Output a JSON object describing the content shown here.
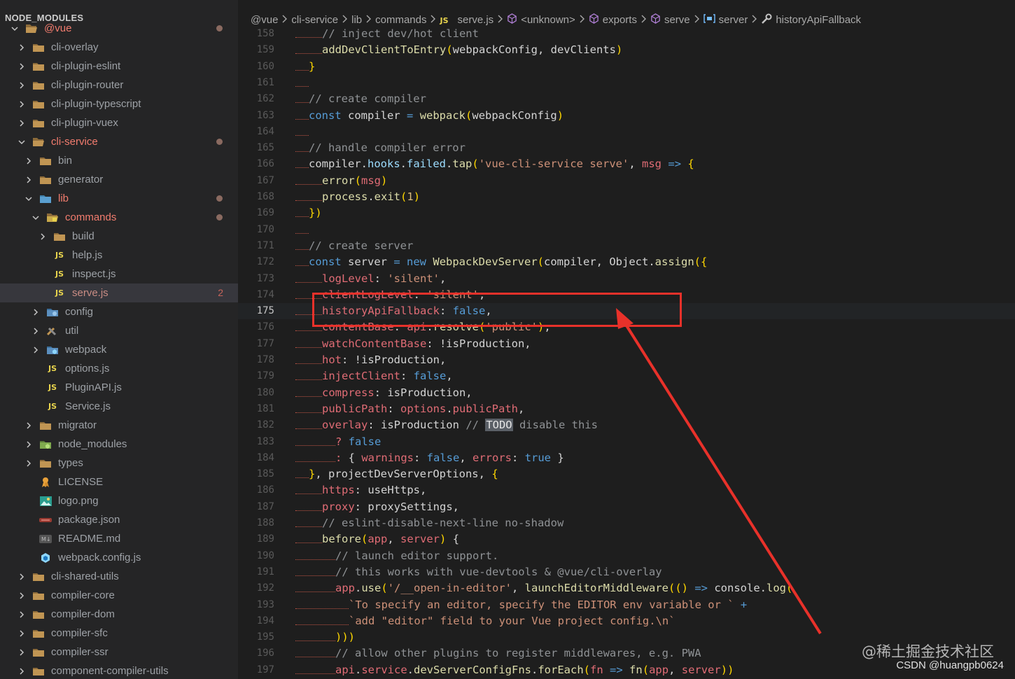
{
  "sidebar": {
    "title": "NODE_MODULES",
    "items": [
      {
        "label": "@vue",
        "icon": "folder-open-icon",
        "chevron": "down",
        "indent": 0,
        "state": "red",
        "dot": true
      },
      {
        "label": "cli-overlay",
        "icon": "folder-icon",
        "chevron": "right",
        "indent": 1,
        "state": ""
      },
      {
        "label": "cli-plugin-eslint",
        "icon": "folder-icon",
        "chevron": "right",
        "indent": 1,
        "state": ""
      },
      {
        "label": "cli-plugin-router",
        "icon": "folder-icon",
        "chevron": "right",
        "indent": 1,
        "state": ""
      },
      {
        "label": "cli-plugin-typescript",
        "icon": "folder-icon",
        "chevron": "right",
        "indent": 1,
        "state": ""
      },
      {
        "label": "cli-plugin-vuex",
        "icon": "folder-icon",
        "chevron": "right",
        "indent": 1,
        "state": ""
      },
      {
        "label": "cli-service",
        "icon": "folder-open-icon",
        "chevron": "down",
        "indent": 1,
        "state": "red",
        "dot": true
      },
      {
        "label": "bin",
        "icon": "bin-folder-icon",
        "chevron": "right",
        "indent": 2,
        "state": ""
      },
      {
        "label": "generator",
        "icon": "folder-icon",
        "chevron": "right",
        "indent": 2,
        "state": ""
      },
      {
        "label": "lib",
        "icon": "lib-folder-icon",
        "chevron": "down",
        "indent": 2,
        "state": "red",
        "dot": true
      },
      {
        "label": "commands",
        "icon": "commands-folder-icon",
        "chevron": "down",
        "indent": 3,
        "state": "red",
        "dot": true
      },
      {
        "label": "build",
        "icon": "folder-icon",
        "chevron": "right",
        "indent": 4,
        "state": ""
      },
      {
        "label": "help.js",
        "icon": "js-file-icon",
        "chevron": "none",
        "indent": 4,
        "state": ""
      },
      {
        "label": "inspect.js",
        "icon": "js-file-icon",
        "chevron": "none",
        "indent": 4,
        "state": ""
      },
      {
        "label": "serve.js",
        "icon": "js-file-icon",
        "chevron": "none",
        "indent": 4,
        "state": "redfaded",
        "active": true,
        "count": "2"
      },
      {
        "label": "config",
        "icon": "config-folder-icon",
        "chevron": "right",
        "indent": 3,
        "state": ""
      },
      {
        "label": "util",
        "icon": "util-folder-icon",
        "chevron": "right",
        "indent": 3,
        "state": ""
      },
      {
        "label": "webpack",
        "icon": "webpack-folder-icon",
        "chevron": "right",
        "indent": 3,
        "state": ""
      },
      {
        "label": "options.js",
        "icon": "js-file-icon",
        "chevron": "none",
        "indent": 3,
        "state": ""
      },
      {
        "label": "PluginAPI.js",
        "icon": "js-file-icon",
        "chevron": "none",
        "indent": 3,
        "state": ""
      },
      {
        "label": "Service.js",
        "icon": "js-file-icon",
        "chevron": "none",
        "indent": 3,
        "state": ""
      },
      {
        "label": "migrator",
        "icon": "folder-icon",
        "chevron": "right",
        "indent": 2,
        "state": ""
      },
      {
        "label": "node_modules",
        "icon": "node-folder-icon",
        "chevron": "right",
        "indent": 2,
        "state": ""
      },
      {
        "label": "types",
        "icon": "folder-icon",
        "chevron": "right",
        "indent": 2,
        "state": ""
      },
      {
        "label": "LICENSE",
        "icon": "license-icon",
        "chevron": "none",
        "indent": 2,
        "state": ""
      },
      {
        "label": "logo.png",
        "icon": "image-icon",
        "chevron": "none",
        "indent": 2,
        "state": ""
      },
      {
        "label": "package.json",
        "icon": "json-icon",
        "chevron": "none",
        "indent": 2,
        "state": ""
      },
      {
        "label": "README.md",
        "icon": "markdown-icon",
        "chevron": "none",
        "indent": 2,
        "state": ""
      },
      {
        "label": "webpack.config.js",
        "icon": "webpack-icon",
        "chevron": "none",
        "indent": 2,
        "state": ""
      },
      {
        "label": "cli-shared-utils",
        "icon": "folder-icon",
        "chevron": "right",
        "indent": 1,
        "state": ""
      },
      {
        "label": "compiler-core",
        "icon": "folder-icon",
        "chevron": "right",
        "indent": 1,
        "state": ""
      },
      {
        "label": "compiler-dom",
        "icon": "folder-icon",
        "chevron": "right",
        "indent": 1,
        "state": ""
      },
      {
        "label": "compiler-sfc",
        "icon": "folder-icon",
        "chevron": "right",
        "indent": 1,
        "state": ""
      },
      {
        "label": "compiler-ssr",
        "icon": "folder-icon",
        "chevron": "right",
        "indent": 1,
        "state": ""
      },
      {
        "label": "component-compiler-utils",
        "icon": "folder-icon",
        "chevron": "right",
        "indent": 1,
        "state": ""
      }
    ]
  },
  "breadcrumb": [
    {
      "label": "@vue",
      "icon": ""
    },
    {
      "label": "cli-service",
      "icon": ""
    },
    {
      "label": "lib",
      "icon": ""
    },
    {
      "label": "commands",
      "icon": ""
    },
    {
      "label": "serve.js",
      "icon": "js-file-icon"
    },
    {
      "label": "<unknown>",
      "icon": "module-icon"
    },
    {
      "label": "exports",
      "icon": "module-icon"
    },
    {
      "label": "serve",
      "icon": "module-icon"
    },
    {
      "label": "server",
      "icon": "variable-icon"
    },
    {
      "label": "historyApiFallback",
      "icon": "wrench-icon"
    }
  ],
  "editor": {
    "current_line": 175,
    "lines": [
      {
        "n": "158",
        "indent": 2,
        "t": [
          [
            "c",
            "// inject dev/hot client"
          ]
        ]
      },
      {
        "n": "159",
        "indent": 2,
        "t": [
          [
            "f",
            "addDevClientToEntry"
          ],
          [
            "b",
            "("
          ],
          [
            "",
            "webpackConfig, devClients"
          ],
          [
            "b",
            ")"
          ]
        ]
      },
      {
        "n": "160",
        "indent": 1,
        "t": [
          [
            "b",
            "}"
          ]
        ]
      },
      {
        "n": "161",
        "indent": 0,
        "t": []
      },
      {
        "n": "162",
        "indent": 1,
        "t": [
          [
            "c",
            "// create compiler"
          ]
        ]
      },
      {
        "n": "163",
        "indent": 1,
        "t": [
          [
            "k",
            "const"
          ],
          [
            "",
            " compiler "
          ],
          [
            "k",
            "="
          ],
          [
            "",
            " "
          ],
          [
            "f",
            "webpack"
          ],
          [
            "b",
            "("
          ],
          [
            "",
            "webpackConfig"
          ],
          [
            "b",
            ")"
          ]
        ]
      },
      {
        "n": "164",
        "indent": 0,
        "t": []
      },
      {
        "n": "165",
        "indent": 1,
        "t": [
          [
            "c",
            "// handle compiler error"
          ]
        ]
      },
      {
        "n": "166",
        "indent": 1,
        "t": [
          [
            "",
            "compiler."
          ],
          [
            "v",
            "hooks"
          ],
          [
            "",
            "."
          ],
          [
            "v",
            "failed"
          ],
          [
            "",
            "."
          ],
          [
            "f",
            "tap"
          ],
          [
            "b",
            "("
          ],
          [
            "s",
            "'vue-cli-service serve'"
          ],
          [
            "",
            ", "
          ],
          [
            "p",
            "msg"
          ],
          [
            "",
            " "
          ],
          [
            "k",
            "=>"
          ],
          [
            "",
            " "
          ],
          [
            "b",
            "{"
          ]
        ]
      },
      {
        "n": "167",
        "indent": 2,
        "t": [
          [
            "f",
            "error"
          ],
          [
            "b",
            "("
          ],
          [
            "p",
            "msg"
          ],
          [
            "b",
            ")"
          ]
        ]
      },
      {
        "n": "168",
        "indent": 2,
        "t": [
          [
            "f",
            "process"
          ],
          [
            "",
            "."
          ],
          [
            "f",
            "exit"
          ],
          [
            "b",
            "("
          ],
          [
            "sy",
            "1"
          ],
          [
            "b",
            ")"
          ]
        ]
      },
      {
        "n": "169",
        "indent": 1,
        "t": [
          [
            "b",
            "})"
          ]
        ]
      },
      {
        "n": "170",
        "indent": 0,
        "t": []
      },
      {
        "n": "171",
        "indent": 1,
        "t": [
          [
            "c",
            "// create server"
          ]
        ]
      },
      {
        "n": "172",
        "indent": 1,
        "t": [
          [
            "k",
            "const"
          ],
          [
            "",
            " server "
          ],
          [
            "k",
            "="
          ],
          [
            "",
            " "
          ],
          [
            "k",
            "new"
          ],
          [
            "",
            " "
          ],
          [
            "f",
            "WebpackDevServer"
          ],
          [
            "b",
            "("
          ],
          [
            "",
            "compiler, Object."
          ],
          [
            "f",
            "assign"
          ],
          [
            "b",
            "({"
          ]
        ]
      },
      {
        "n": "173",
        "indent": 2,
        "t": [
          [
            "p",
            "logLevel"
          ],
          [
            "",
            ": "
          ],
          [
            "s",
            "'silent'"
          ],
          [
            "",
            ","
          ]
        ]
      },
      {
        "n": "174",
        "indent": 2,
        "t": [
          [
            "p",
            "clientLogLevel"
          ],
          [
            "",
            ": "
          ],
          [
            "s",
            "'silent'"
          ],
          [
            "",
            ","
          ]
        ]
      },
      {
        "n": "175",
        "indent": 2,
        "t": [
          [
            "p",
            "historyApiFallback"
          ],
          [
            "",
            ": "
          ],
          [
            "k",
            "false"
          ],
          [
            "",
            ","
          ]
        ]
      },
      {
        "n": "176",
        "indent": 2,
        "t": [
          [
            "p",
            "contentBase"
          ],
          [
            "",
            ": "
          ],
          [
            "p",
            "api"
          ],
          [
            "",
            "."
          ],
          [
            "f",
            "resolve"
          ],
          [
            "b",
            "("
          ],
          [
            "s",
            "'public'"
          ],
          [
            "b",
            ")"
          ],
          [
            "",
            ","
          ]
        ]
      },
      {
        "n": "177",
        "indent": 2,
        "t": [
          [
            "p",
            "watchContentBase"
          ],
          [
            "",
            ": !isProduction,"
          ]
        ]
      },
      {
        "n": "178",
        "indent": 2,
        "t": [
          [
            "p",
            "hot"
          ],
          [
            "",
            ": !isProduction,"
          ]
        ]
      },
      {
        "n": "179",
        "indent": 2,
        "t": [
          [
            "p",
            "injectClient"
          ],
          [
            "",
            ": "
          ],
          [
            "k",
            "false"
          ],
          [
            "",
            ","
          ]
        ]
      },
      {
        "n": "180",
        "indent": 2,
        "t": [
          [
            "p",
            "compress"
          ],
          [
            "",
            ": isProduction,"
          ]
        ]
      },
      {
        "n": "181",
        "indent": 2,
        "t": [
          [
            "p",
            "publicPath"
          ],
          [
            "",
            ": "
          ],
          [
            "p",
            "options"
          ],
          [
            "",
            "."
          ],
          [
            "p",
            "publicPath"
          ],
          [
            "",
            ","
          ]
        ]
      },
      {
        "n": "182",
        "indent": 2,
        "t": [
          [
            "p",
            "overlay"
          ],
          [
            "",
            ": isProduction "
          ],
          [
            "c",
            "// "
          ],
          [
            "todo",
            "TODO"
          ],
          [
            "c",
            " disable this"
          ]
        ]
      },
      {
        "n": "183",
        "indent": 3,
        "t": [
          [
            "p",
            "?"
          ],
          [
            "",
            " "
          ],
          [
            "k",
            "false"
          ]
        ]
      },
      {
        "n": "184",
        "indent": 3,
        "t": [
          [
            "p",
            ":"
          ],
          [
            "",
            " { "
          ],
          [
            "p",
            "warnings"
          ],
          [
            "",
            ": "
          ],
          [
            "k",
            "false"
          ],
          [
            "",
            ", "
          ],
          [
            "p",
            "errors"
          ],
          [
            "",
            ": "
          ],
          [
            "k",
            "true"
          ],
          [
            "",
            " }"
          ]
        ]
      },
      {
        "n": "185",
        "indent": 1,
        "t": [
          [
            "b",
            "}"
          ],
          [
            "",
            ", projectDevServerOptions, "
          ],
          [
            "b",
            "{"
          ]
        ]
      },
      {
        "n": "186",
        "indent": 2,
        "t": [
          [
            "p",
            "https"
          ],
          [
            "",
            ": useHttps,"
          ]
        ]
      },
      {
        "n": "187",
        "indent": 2,
        "t": [
          [
            "p",
            "proxy"
          ],
          [
            "",
            ": proxySettings,"
          ]
        ]
      },
      {
        "n": "188",
        "indent": 2,
        "t": [
          [
            "c",
            "// eslint-disable-next-line no-shadow"
          ]
        ]
      },
      {
        "n": "189",
        "indent": 2,
        "t": [
          [
            "f",
            "before"
          ],
          [
            "b",
            "("
          ],
          [
            "p",
            "app"
          ],
          [
            "",
            ", "
          ],
          [
            "p",
            "server"
          ],
          [
            "b",
            ")"
          ],
          [
            "",
            " {"
          ]
        ]
      },
      {
        "n": "190",
        "indent": 3,
        "t": [
          [
            "c",
            "// launch editor support."
          ]
        ]
      },
      {
        "n": "191",
        "indent": 3,
        "t": [
          [
            "c",
            "// this works with vue-devtools & @vue/cli-overlay"
          ]
        ]
      },
      {
        "n": "192",
        "indent": 3,
        "t": [
          [
            "p",
            "app"
          ],
          [
            "",
            "."
          ],
          [
            "f",
            "use"
          ],
          [
            "b",
            "("
          ],
          [
            "s",
            "'/__open-in-editor'"
          ],
          [
            "",
            ", "
          ],
          [
            "f",
            "launchEditorMiddleware"
          ],
          [
            "b",
            "("
          ],
          [
            "b",
            "()"
          ],
          [
            "",
            " "
          ],
          [
            "k",
            "=>"
          ],
          [
            "",
            " console."
          ],
          [
            "f",
            "log"
          ],
          [
            "b",
            "("
          ]
        ]
      },
      {
        "n": "193",
        "indent": 4,
        "t": [
          [
            "s",
            "`To specify an editor, specify the EDITOR env variable or `"
          ],
          [
            "",
            " "
          ],
          [
            "k",
            "+"
          ]
        ]
      },
      {
        "n": "194",
        "indent": 4,
        "t": [
          [
            "s",
            "`add \"editor\" field to your Vue project config.\\n`"
          ]
        ]
      },
      {
        "n": "195",
        "indent": 3,
        "t": [
          [
            "b",
            ")))"
          ]
        ]
      },
      {
        "n": "196",
        "indent": 3,
        "t": [
          [
            "c",
            "// allow other plugins to register middlewares, e.g. PWA"
          ]
        ]
      },
      {
        "n": "197",
        "indent": 3,
        "t": [
          [
            "p",
            "api"
          ],
          [
            "",
            "."
          ],
          [
            "p",
            "service"
          ],
          [
            "",
            "."
          ],
          [
            "f",
            "devServerConfigFns"
          ],
          [
            "",
            "."
          ],
          [
            "f",
            "forEach"
          ],
          [
            "b",
            "("
          ],
          [
            "p",
            "fn"
          ],
          [
            "",
            " "
          ],
          [
            "k",
            "=>"
          ],
          [
            "",
            " "
          ],
          [
            "f",
            "fn"
          ],
          [
            "b",
            "("
          ],
          [
            "p",
            "app"
          ],
          [
            "",
            ", "
          ],
          [
            "p",
            "server"
          ],
          [
            "b",
            "))"
          ]
        ]
      }
    ]
  },
  "watermark": {
    "line1": "@稀土掘金技术社区",
    "line2": "CSDN @huangpb0624"
  },
  "colors": {
    "annotation_red": "#e8312a",
    "folder": "#c09553",
    "js": "#e8d44d"
  }
}
